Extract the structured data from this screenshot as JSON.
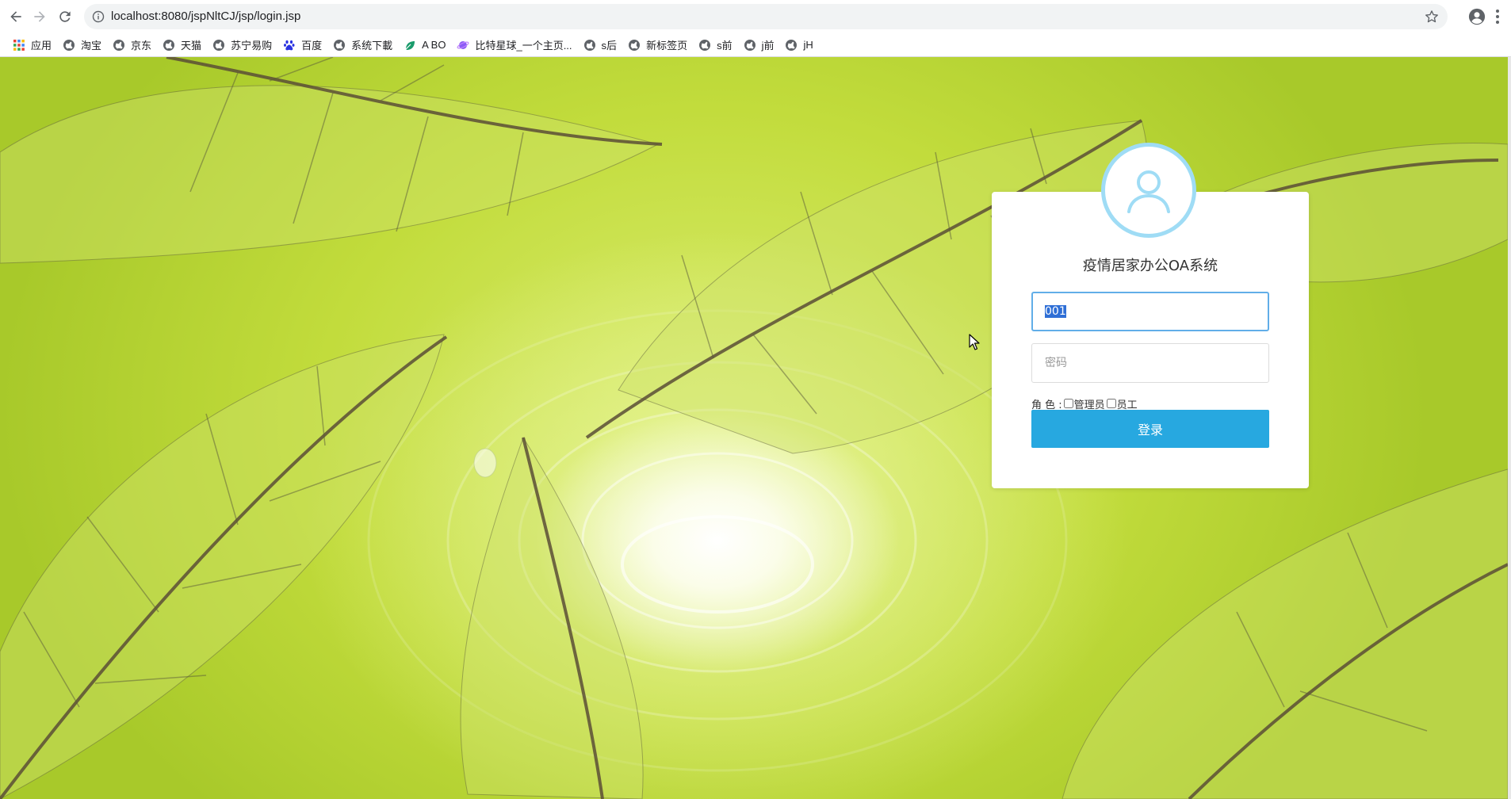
{
  "browser": {
    "url": "localhost:8080/jspNltCJ/jsp/login.jsp",
    "bookmarks": [
      {
        "label": "应用",
        "icon": "apps-grid-icon"
      },
      {
        "label": "淘宝",
        "icon": "globe-icon"
      },
      {
        "label": "京东",
        "icon": "globe-icon"
      },
      {
        "label": "天猫",
        "icon": "globe-icon"
      },
      {
        "label": "苏宁易购",
        "icon": "globe-icon"
      },
      {
        "label": "百度",
        "icon": "baidu-paw-icon"
      },
      {
        "label": "系统下載",
        "icon": "globe-icon"
      },
      {
        "label": "A BO",
        "icon": "leaf-icon"
      },
      {
        "label": "比特星球_一个主页...",
        "icon": "planet-icon"
      },
      {
        "label": "s后",
        "icon": "globe-icon"
      },
      {
        "label": "新标签页",
        "icon": "globe-icon"
      },
      {
        "label": "s前",
        "icon": "globe-icon"
      },
      {
        "label": "j前",
        "icon": "globe-icon"
      },
      {
        "label": "jH",
        "icon": "globe-icon"
      }
    ]
  },
  "login": {
    "title": "疫情居家办公OA系统",
    "username_value": "001",
    "password_placeholder": "密码",
    "role_label": "角 色 :",
    "roles": [
      "管理员",
      "员工"
    ],
    "submit_label": "登录"
  },
  "colors": {
    "accent": "#27a8e0",
    "avatar_ring": "#9fdcf5",
    "focus_border": "#61aee8",
    "leaf_vein": "#5a5a3a"
  }
}
